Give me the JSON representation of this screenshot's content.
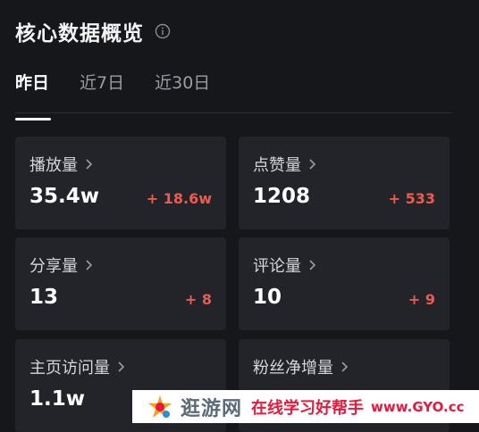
{
  "header": {
    "title": "核心数据概览",
    "info_icon": "info-circle-icon"
  },
  "tabs": [
    {
      "label": "昨日",
      "active": true
    },
    {
      "label": "近7日",
      "active": false
    },
    {
      "label": "近30日",
      "active": false
    }
  ],
  "cards": [
    {
      "label": "播放量",
      "value": "35.4w",
      "delta": "+ 18.6w"
    },
    {
      "label": "点赞量",
      "value": "1208",
      "delta": "+ 533"
    },
    {
      "label": "分享量",
      "value": "13",
      "delta": "+ 8"
    },
    {
      "label": "评论量",
      "value": "10",
      "delta": "+ 9"
    },
    {
      "label": "主页访问量",
      "value": "1.1w",
      "delta": ""
    },
    {
      "label": "粉丝净增量",
      "value": "",
      "delta": ""
    }
  ],
  "watermark": {
    "brand": "逛游网",
    "slogan": "在线学习好帮手",
    "url": "www.GYO.cc"
  },
  "colors": {
    "background": "#16171b",
    "card": "#232429",
    "delta_red": "#f05a4c",
    "watermark_red": "#e8193c"
  }
}
